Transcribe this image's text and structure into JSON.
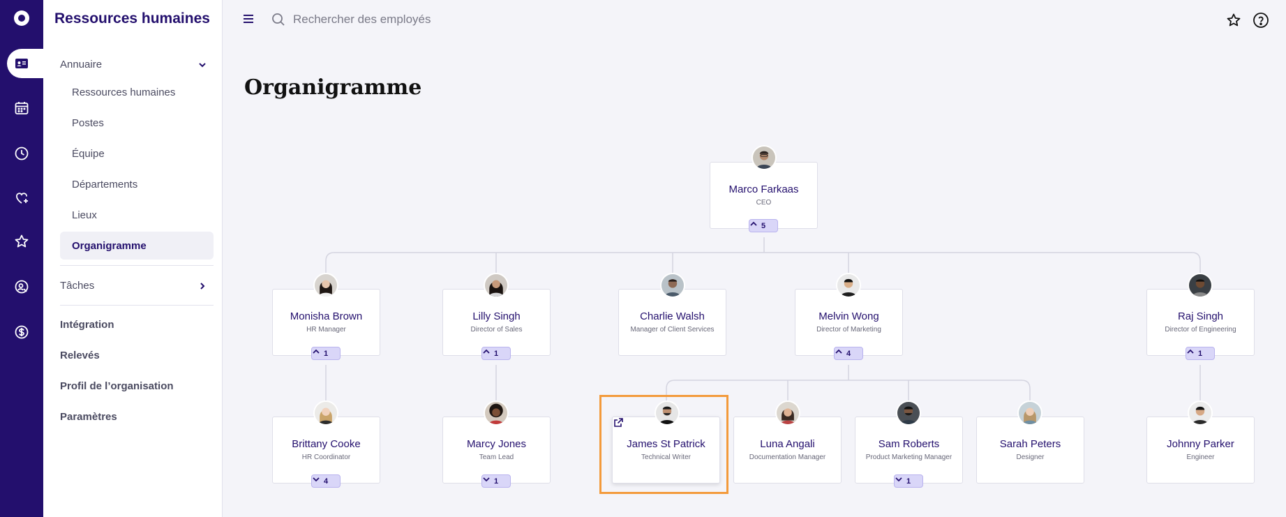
{
  "app": {
    "title": "Ressources humaines"
  },
  "rail": {
    "items": [
      {
        "icon": "logo-icon"
      },
      {
        "icon": "id-card-icon",
        "active": true
      },
      {
        "icon": "calendar-icon"
      },
      {
        "icon": "clock-icon"
      },
      {
        "icon": "heart-plus-icon"
      },
      {
        "icon": "star-icon"
      },
      {
        "icon": "person-search-icon"
      },
      {
        "icon": "dollar-icon"
      }
    ]
  },
  "sidebar": {
    "sections": {
      "annuaire": "Annuaire",
      "taches": "Tâches"
    },
    "annuaire_items": [
      {
        "label": "Ressources humaines"
      },
      {
        "label": "Postes"
      },
      {
        "label": "Équipe"
      },
      {
        "label": "Départements"
      },
      {
        "label": "Lieux"
      },
      {
        "label": "Organigramme",
        "active": true
      }
    ],
    "links": [
      {
        "label": "Intégration"
      },
      {
        "label": "Relevés"
      },
      {
        "label": "Profil de l’organisation"
      },
      {
        "label": "Paramètres"
      }
    ]
  },
  "search": {
    "placeholder": "Rechercher des employés"
  },
  "page": {
    "title": "Organigramme"
  },
  "org": {
    "ceo": {
      "name": "Marco Farkaas",
      "role": "CEO",
      "count": "5",
      "expanded": true
    },
    "level1": [
      {
        "name": "Monisha Brown",
        "role": "HR Manager",
        "count": "1",
        "expanded": true
      },
      {
        "name": "Lilly Singh",
        "role": "Director of Sales",
        "count": "1",
        "expanded": true
      },
      {
        "name": "Charlie Walsh",
        "role": "Manager of Client Services",
        "count": null
      },
      {
        "name": "Melvin Wong",
        "role": "Director of Marketing",
        "count": "4",
        "expanded": true
      },
      {
        "name": "Raj Singh",
        "role": "Director of Engineering",
        "count": "1",
        "expanded": true
      }
    ],
    "level2": [
      {
        "name": "Brittany Cooke",
        "role": "HR Coordinator",
        "count": "4",
        "expanded": false
      },
      {
        "name": "Marcy Jones",
        "role": "Team Lead",
        "count": "1",
        "expanded": false
      },
      {
        "name": "James St Patrick",
        "role": "Technical Writer",
        "count": null,
        "selected": true
      },
      {
        "name": "Luna Angali",
        "role": "Documentation Manager",
        "count": null
      },
      {
        "name": "Sam Roberts",
        "role": "Product Marketing Manager",
        "count": "1",
        "expanded": false
      },
      {
        "name": "Sarah Peters",
        "role": "Designer",
        "count": null
      },
      {
        "name": "Johnny Parker",
        "role": "Engineer",
        "count": null
      }
    ]
  },
  "colors": {
    "brand": "#230f6d",
    "badge": "#d9d6f8",
    "highlight": "#f39a3b"
  }
}
